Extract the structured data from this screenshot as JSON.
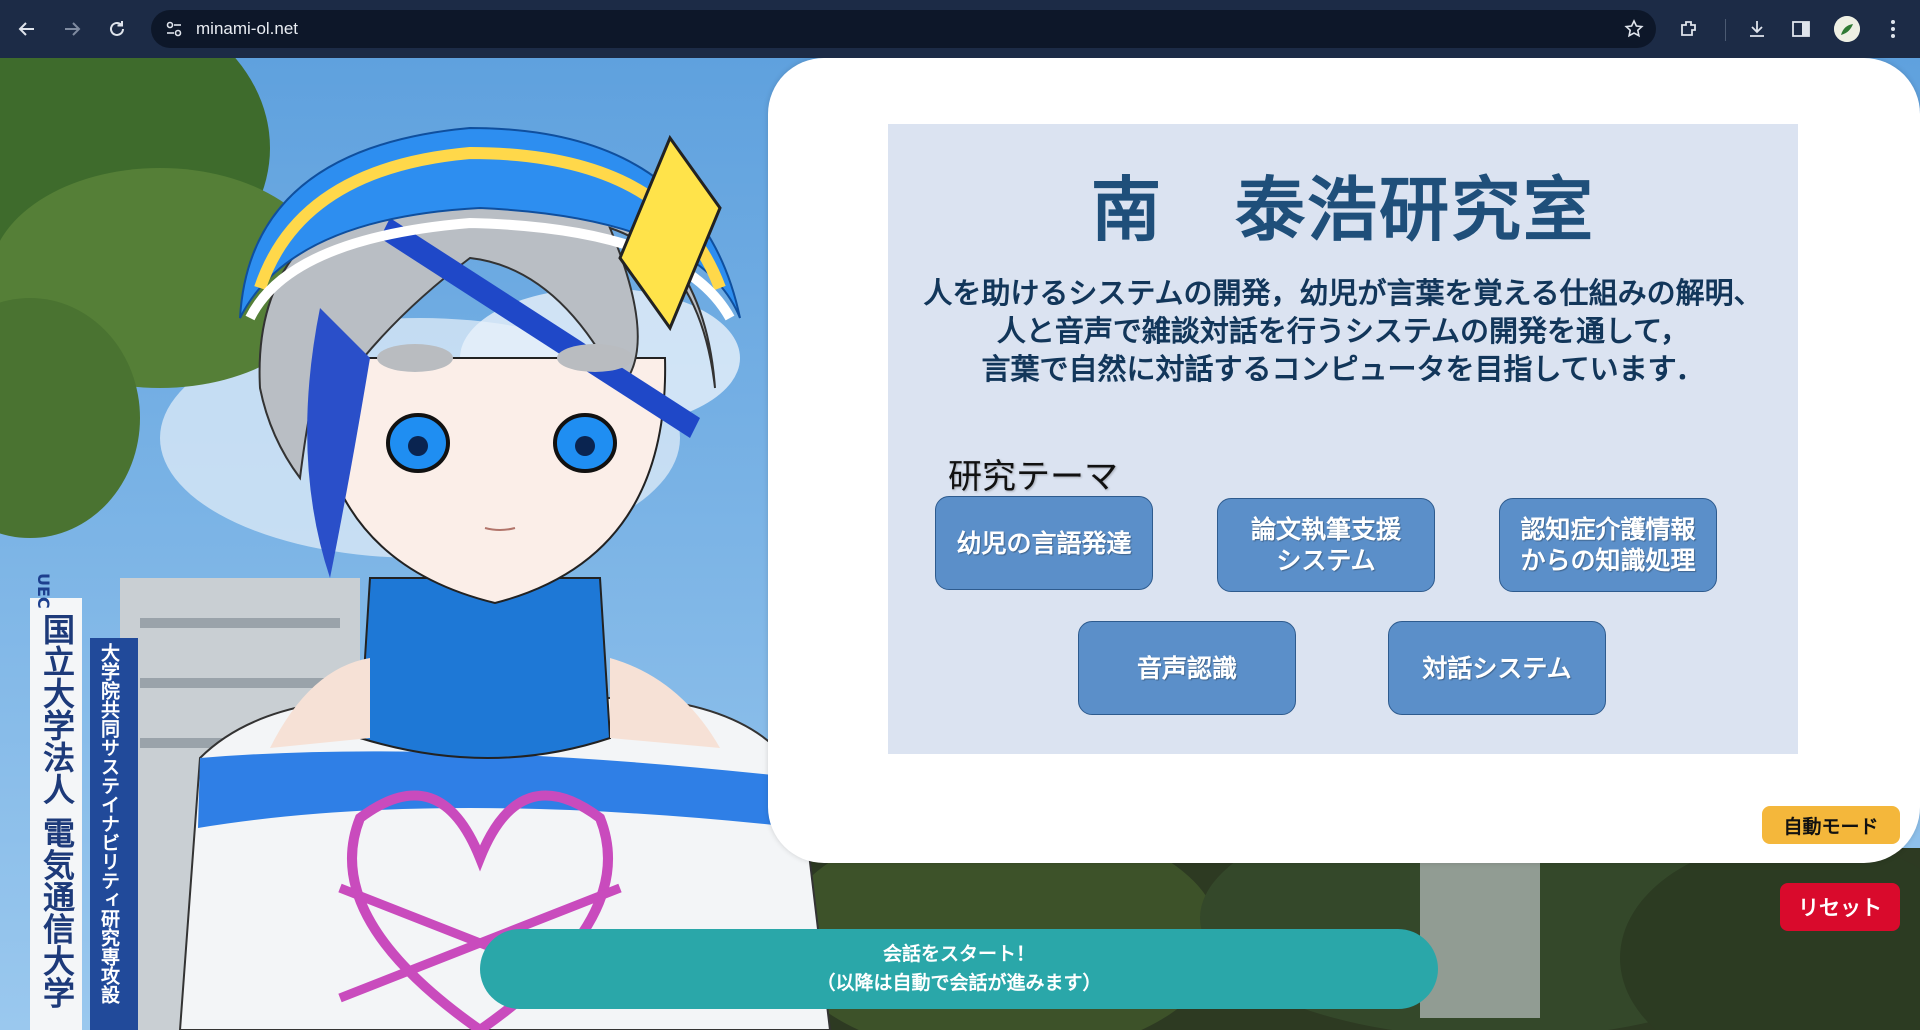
{
  "browser": {
    "url": "minami-ol.net"
  },
  "panel": {
    "title": "南　泰浩研究室",
    "description_lines": [
      "人を助けるシステムの開発，幼児が言葉を覚える仕組みの解明、",
      "人と音声で雑談対話を行うシステムの開発を通して，",
      "言葉で自然に対話するコンピュータを目指しています．"
    ],
    "theme_heading": "研究テーマ",
    "themes": [
      "幼児の言語発達",
      "論文執筆支援\nシステム",
      "認知症介護情報\nからの知識処理",
      "音声認識",
      "対話システム"
    ]
  },
  "controls": {
    "auto_mode": "自動モード",
    "reset": "リセット",
    "start_line1": "会話をスタート！",
    "start_line2": "（以降は自動で会話が進みます）"
  },
  "background": {
    "banner_left_logo": "UEC",
    "banner_left_text": "国立大学法人 電気通信大学",
    "banner_right_text": "大学院共同サステイナビリティ研究専攻設"
  },
  "colors": {
    "chrome": "#1c2b46",
    "panel_box": "#dbe3f1",
    "title": "#1f4f7a",
    "theme_button": "#5b8fc9",
    "auto_mode": "#f4b73b",
    "reset": "#d90a2c",
    "start": "#2aa7a9"
  },
  "icons": [
    "back-arrow-icon",
    "forward-arrow-icon",
    "reload-icon",
    "site-info-icon",
    "star-icon",
    "extensions-icon",
    "download-icon",
    "side-panel-icon",
    "profile-avatar-icon",
    "menu-dots-icon"
  ]
}
